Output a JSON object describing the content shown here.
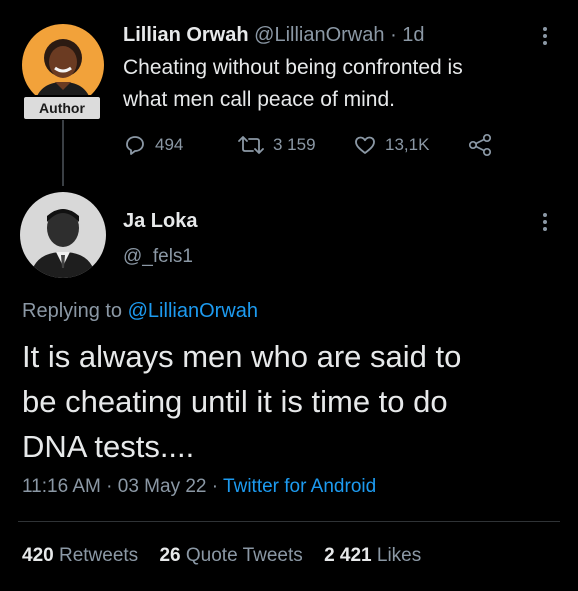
{
  "parent_tweet": {
    "badge": "Author",
    "display_name": "Lillian Orwah",
    "handle": "@LillianOrwah",
    "separator": "·",
    "time_ago": "1d",
    "text_lines": [
      "Cheating without being confronted is",
      "what men call peace of mind."
    ],
    "actions": {
      "replies": "494",
      "retweets": "3 159",
      "likes": "13,1K"
    }
  },
  "reply_tweet": {
    "display_name": "Ja Loka",
    "handle": "@_fels1",
    "replying_prefix": "Replying to",
    "replying_to": "@LillianOrwah",
    "text_lines": [
      "It is always men who are said to",
      "be cheating until it is time to do",
      "DNA tests...."
    ],
    "time": "11:16 AM",
    "date": "03 May 22",
    "separator": "·",
    "source": "Twitter for Android",
    "stats": {
      "retweets_count": "420",
      "retweets_label": "Retweets",
      "quotes_count": "26",
      "quotes_label": "Quote Tweets",
      "likes_count": "2 421",
      "likes_label": "Likes"
    }
  },
  "icons": {
    "reply": "reply-icon",
    "retweet": "retweet-icon",
    "like": "heart-icon",
    "share": "share-icon",
    "more": "more-icon"
  },
  "colors": {
    "background": "#000000",
    "text_primary": "#e7e9ea",
    "text_secondary": "#8b98a5",
    "link": "#1d9bf0",
    "badge_bg": "#dcdcdc",
    "avatar_parent_bg": "#f2a23a",
    "divider": "#2f3336"
  }
}
